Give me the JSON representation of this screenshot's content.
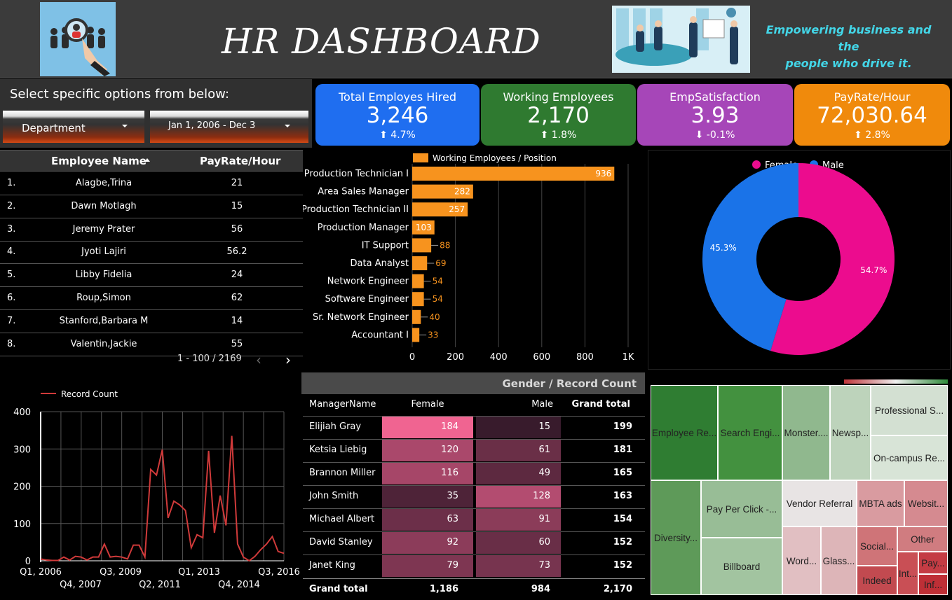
{
  "header": {
    "title": "HR DASHBOARD",
    "tagline_line1": "Empowering business and the",
    "tagline_line2": "people who drive it."
  },
  "filters": {
    "prompt": "Select specific options from below:",
    "department_label": "Department",
    "date_range_label": "Jan 1, 2006 - Dec 3"
  },
  "kpis": [
    {
      "label": "Total Employes Hired",
      "value": "3,246",
      "delta": "4.7%",
      "direction": "up",
      "color": "#1f6ef0"
    },
    {
      "label": "Working Employees",
      "value": "2,170",
      "delta": "1.8%",
      "direction": "up",
      "color": "#2f7a30"
    },
    {
      "label": "EmpSatisfaction",
      "value": "3.93",
      "delta": "-0.1%",
      "direction": "down",
      "color": "#a646b8"
    },
    {
      "label": "PayRate/Hour",
      "value": "72,030.64",
      "delta": "2.8%",
      "direction": "up",
      "color": "#f08a0c"
    }
  ],
  "employee_table": {
    "col_name": "Employee Name",
    "col_pay": "PayRate/Hour",
    "rows": [
      {
        "idx": "1.",
        "name": "Alagbe,Trina",
        "pay": "21"
      },
      {
        "idx": "2.",
        "name": "Dawn Motlagh",
        "pay": "15"
      },
      {
        "idx": "3.",
        "name": "Jeremy Prater",
        "pay": "56"
      },
      {
        "idx": "4.",
        "name": "Jyoti Lajiri",
        "pay": "56.2"
      },
      {
        "idx": "5.",
        "name": "Libby Fidelia",
        "pay": "24"
      },
      {
        "idx": "6.",
        "name": "Roup,Simon",
        "pay": "62"
      },
      {
        "idx": "7.",
        "name": "Stanford,Barbara M",
        "pay": "14"
      },
      {
        "idx": "8.",
        "name": "Valentin,Jackie",
        "pay": "55"
      }
    ],
    "pager": "1 - 100 / 2169"
  },
  "chart_data": [
    {
      "type": "bar",
      "orientation": "horizontal",
      "legend": "Working Employees / Position",
      "color": "#f7931e",
      "categories": [
        "Production Technician I",
        "Area Sales Manager",
        "Production Technician II",
        "Production Manager",
        "IT Support",
        "Data Analyst",
        "Network Engineer",
        "Software Engineer",
        "Sr. Network Engineer",
        "Accountant I"
      ],
      "values": [
        936,
        282,
        257,
        103,
        88,
        69,
        54,
        54,
        40,
        33
      ],
      "xticks": [
        "0",
        "200",
        "400",
        "600",
        "800",
        "1K"
      ],
      "xlim": [
        0,
        1000
      ]
    },
    {
      "type": "pie",
      "donut": true,
      "labels": [
        "Female",
        "Male"
      ],
      "values": [
        54.7,
        45.3
      ],
      "value_labels": [
        "54.7%",
        "45.3%"
      ],
      "colors": [
        "#ec0c8e",
        "#1a73e8"
      ],
      "legend_position": "top"
    },
    {
      "type": "line",
      "legend": "Record Count",
      "color": "#d03a3a",
      "ylim": [
        0,
        400
      ],
      "yticks": [
        "0",
        "100",
        "200",
        "300",
        "400"
      ],
      "xticks_top": [
        "Q1, 2006",
        "Q3, 2009",
        "Q1, 2013",
        "Q3, 2016"
      ],
      "xticks_bottom": [
        "Q4, 2007",
        "Q2, 2011",
        "Q4, 2014"
      ],
      "x": [
        "Q1 2006",
        "Q2 2006",
        "Q3 2006",
        "Q4 2006",
        "Q1 2007",
        "Q2 2007",
        "Q3 2007",
        "Q4 2007",
        "Q1 2008",
        "Q2 2008",
        "Q3 2008",
        "Q4 2008",
        "Q1 2009",
        "Q2 2009",
        "Q3 2009",
        "Q4 2009",
        "Q1 2010",
        "Q2 2010",
        "Q3 2010",
        "Q4 2010",
        "Q1 2011",
        "Q2 2011",
        "Q3 2011",
        "Q4 2011",
        "Q1 2012",
        "Q2 2012",
        "Q3 2012",
        "Q4 2012",
        "Q1 2013",
        "Q2 2013",
        "Q3 2013",
        "Q4 2013",
        "Q1 2014",
        "Q2 2014",
        "Q3 2014",
        "Q4 2014",
        "Q1 2015",
        "Q2 2015",
        "Q3 2015",
        "Q4 2015",
        "Q1 2016",
        "Q2 2016",
        "Q3 2016"
      ],
      "values": [
        5,
        2,
        1,
        1,
        10,
        2,
        12,
        10,
        2,
        10,
        10,
        45,
        10,
        12,
        10,
        5,
        42,
        42,
        10,
        245,
        230,
        298,
        115,
        160,
        150,
        135,
        35,
        70,
        62,
        295,
        75,
        175,
        95,
        335,
        45,
        10,
        0,
        12,
        30,
        45,
        65,
        25,
        20
      ]
    },
    {
      "type": "table",
      "title": "Gender / Record Count",
      "columns": [
        "ManagerName",
        "Female",
        "Male",
        "Grand total"
      ],
      "rows": [
        [
          "Elijiah Gray",
          184,
          15,
          199
        ],
        [
          "Ketsia Liebig",
          120,
          61,
          181
        ],
        [
          "Brannon Miller",
          116,
          49,
          165
        ],
        [
          "John Smith",
          35,
          128,
          163
        ],
        [
          "Michael Albert",
          63,
          91,
          154
        ],
        [
          "David Stanley",
          92,
          60,
          152
        ],
        [
          "Janet King",
          79,
          73,
          152
        ]
      ],
      "totals": [
        "Grand total",
        "1,186",
        "984",
        "2,170"
      ]
    },
    {
      "type": "treemap",
      "labels": [
        "Employee Re...",
        "Search Engi...",
        "Monster....",
        "Newsp...",
        "Professional S...",
        "On-campus Re...",
        "Diversity...",
        "Pay Per Click -...",
        "Billboard",
        "Vendor Referral",
        "MBTA ads",
        "Websit...",
        "Word...",
        "Glass...",
        "Social...",
        "Other",
        "Indeed",
        "Int...",
        "Pay...",
        "Inf..."
      ]
    }
  ]
}
